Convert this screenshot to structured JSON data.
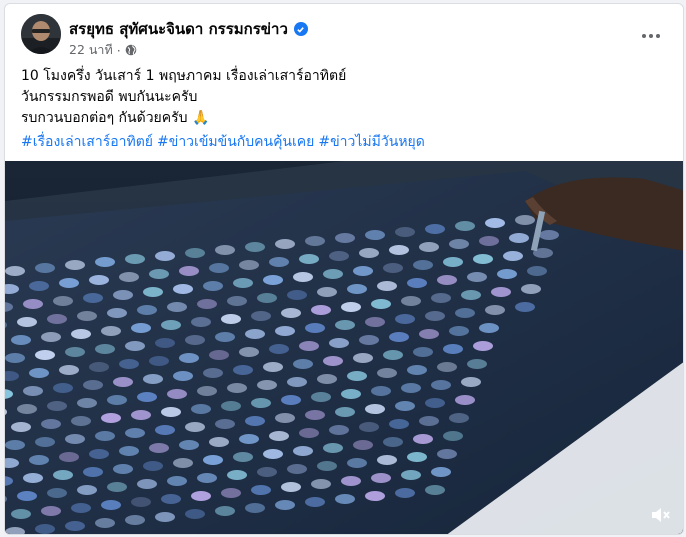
{
  "post": {
    "author": "สรยุทธ สุทัศนะจินดา กรรมกรข่าว",
    "time": "22 นาที",
    "separator": "·",
    "lines": [
      "10 โมงครึ่ง วันเสาร์ 1 พฤษภาคม เรื่องเล่าเสาร์อาทิตย์",
      "วันกรรมกรพอดี พบกันนะครับ",
      "รบกวนบอกต่อๆ กันด้วยครับ"
    ],
    "emoji": "🙏",
    "hashtags": [
      "#เรื่องเล่าเสาร์อาทิตย์",
      "#ข่าวเข้มข้นกับคนคุ้นเคย",
      "#ข่าวไม่มีวันหยุด"
    ]
  },
  "icons": {
    "verified": "verified-badge-icon",
    "audience": "globe-icon",
    "more": "more-options-icon",
    "mute": "muted-speaker-icon"
  },
  "colors": {
    "link": "#1877f2",
    "secondary_text": "#65676b",
    "primary_text": "#050505"
  }
}
